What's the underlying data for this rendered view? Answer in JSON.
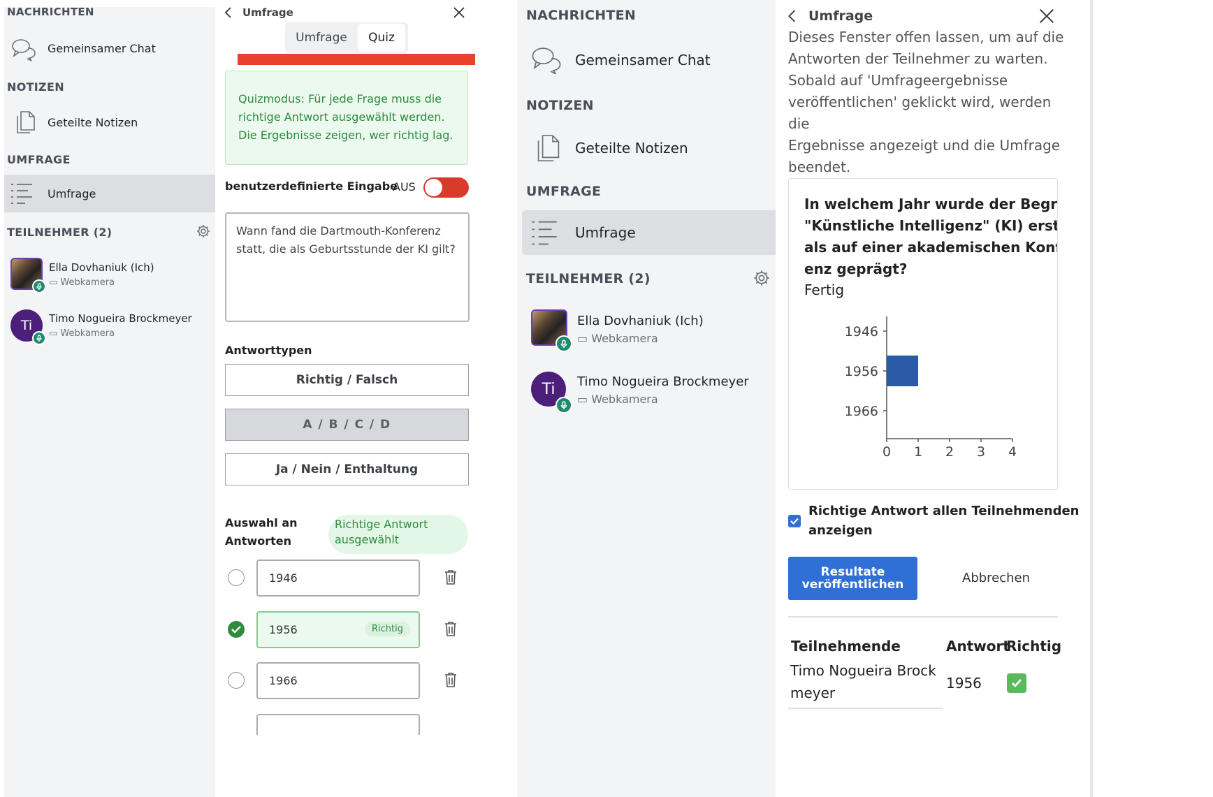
{
  "panel1": {
    "messages_title": "NACHRICHTEN",
    "public_chat": "Gemeinsamer Chat",
    "notes_title": "NOTIZEN",
    "shared_notes": "Geteilte Notizen",
    "poll_title": "UMFRAGE",
    "poll_item": "Umfrage",
    "participants_title": "TEILNEHMER (2)",
    "users": [
      {
        "name": "Ella Dovhaniuk (Ich)",
        "sub": "Webkamera"
      },
      {
        "name": "Timo Nogueira Brockmeyer",
        "sub": "Webkamera",
        "initials": "Ti"
      }
    ]
  },
  "panel2": {
    "header_title": "Umfrage",
    "tabs": [
      "Umfrage",
      "Quiz"
    ],
    "info_text": "Quizmodus: Für jede Frage muss die richtige Antwort ausgewählt werden. Die Ergebnisse zeigen, wer richtig lag.",
    "custom_input_label": "benutzerdefinierte Eingabe",
    "toggle_state": "AUS",
    "question": "Wann fand die Dartmouth-Konferenz statt, die als Geburtsstunde der KI gilt?",
    "answer_types_title": "Antworttypen",
    "answer_types": [
      "Richtig / Falsch",
      "A / B / C / D",
      "Ja / Nein / Enthaltung"
    ],
    "selection_label_1": "Auswahl an",
    "selection_label_2": "Antworten",
    "correct_selected_1": "Richtige Antwort",
    "correct_selected_2": "ausgewählt",
    "answers": [
      "1946",
      "1956",
      "1966"
    ],
    "correct_tag": "Richtig"
  },
  "panel3": {
    "messages_title": "NACHRICHTEN",
    "public_chat": "Gemeinsamer Chat",
    "notes_title": "NOTIZEN",
    "shared_notes": "Geteilte Notizen",
    "poll_title": "UMFRAGE",
    "poll_item": "Umfrage",
    "participants_title": "TEILNEHMER (2)",
    "users": [
      {
        "name": "Ella Dovhaniuk (Ich)",
        "sub": "Webkamera"
      },
      {
        "name": "Timo Nogueira Brockmeyer",
        "sub": "Webkamera",
        "initials": "Ti"
      }
    ]
  },
  "panel4": {
    "header_title": "Umfrage",
    "info_lines": [
      "Dieses Fenster offen lassen, um auf die",
      "Antworten der Teilnehmer zu warten.",
      "Sobald auf 'Umfrageergebnisse",
      "veröffentlichen' geklickt wird, werden die",
      "Ergebnisse angezeigt und die Umfrage",
      "beendet."
    ],
    "question_lines": [
      "In welchem Jahr wurde der Begriff",
      "\"Künstliche Intelligenz\" (KI) erstm",
      "als auf einer akademischen Konfer",
      "enz geprägt?"
    ],
    "status": "Fertig",
    "show_correct_1": "Richtige Antwort allen Teilnehmenden",
    "show_correct_2": "anzeigen",
    "publish_1": "Resultate",
    "publish_2": "veröffentlichen",
    "cancel": "Abbrechen",
    "table_headers": [
      "Teilnehmende",
      "Antwort",
      "Richtig"
    ],
    "table_row": {
      "name_1": "Timo Nogueira Brock",
      "name_2": "meyer",
      "answer": "1956",
      "correct": "✅"
    }
  },
  "chart_data": {
    "type": "bar",
    "orientation": "horizontal",
    "categories": [
      "1946",
      "1956",
      "1966"
    ],
    "values": [
      0,
      1,
      0
    ],
    "xlim": [
      0,
      4
    ],
    "xticks": [
      "0",
      "1",
      "2",
      "3",
      "4"
    ],
    "color": "#2b5aa7",
    "grid": false
  },
  "colors": {
    "accent_blue": "#2f6fd6",
    "red_bar": "#e8412c",
    "green_info_bg": "#ecf9ee",
    "green_text": "#2e8b3e",
    "toggle_red": "#d93b2b"
  }
}
